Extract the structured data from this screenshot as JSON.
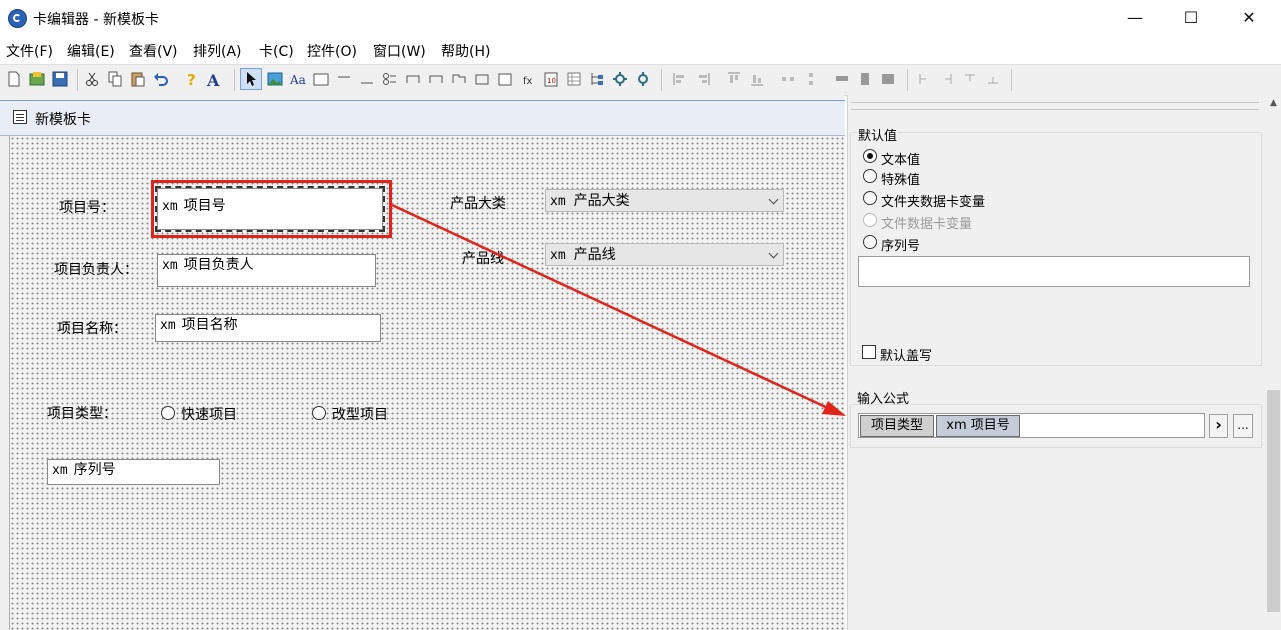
{
  "window": {
    "title": "卡编辑器 - 新模板卡",
    "minimize": "—",
    "maximize": "☐",
    "close": "✕"
  },
  "menu": [
    "文件(F)",
    "编辑(E)",
    "查看(V)",
    "排列(A)",
    "卡(C)",
    "控件(O)",
    "窗口(W)",
    "帮助(H)"
  ],
  "card": {
    "title": "新模板卡",
    "fields": {
      "project_no_label": "项目号：",
      "project_no_prefix": "xm",
      "project_no_value": "项目号",
      "owner_label": "项目负责人：",
      "owner_prefix": "xm",
      "owner_value": "项目负责人",
      "name_label": "项目名称：",
      "name_prefix": "xm",
      "name_value": "项目名称",
      "type_label": "项目类型：",
      "type_option_1": "快速项目",
      "type_option_2": "改型项目",
      "serial_prefix": "xm",
      "serial_value": "序列号",
      "category_label": "产品大类",
      "category_prefix": "xm",
      "category_value": "产品大类",
      "line_label": "产品线",
      "line_prefix": "xm",
      "line_value": "产品线"
    }
  },
  "panel": {
    "default_group_title": "默认值",
    "radio_text_value": "文本值",
    "radio_special_value": "特殊值",
    "radio_folder_var": "文件夹数据卡变量",
    "radio_file_var": "文件数据卡变量",
    "radio_serial": "序列号",
    "default_text_value": "",
    "overwrite_label": "默认盖写",
    "formula_group_title": "输入公式",
    "formula_chip_1": "项目类型",
    "formula_chip_2": "xm 项目号",
    "arrow_button": "›",
    "more_button": "..."
  },
  "colors": {
    "highlight_red": "#e0241b",
    "card_title_bg": "#e9eef6"
  }
}
